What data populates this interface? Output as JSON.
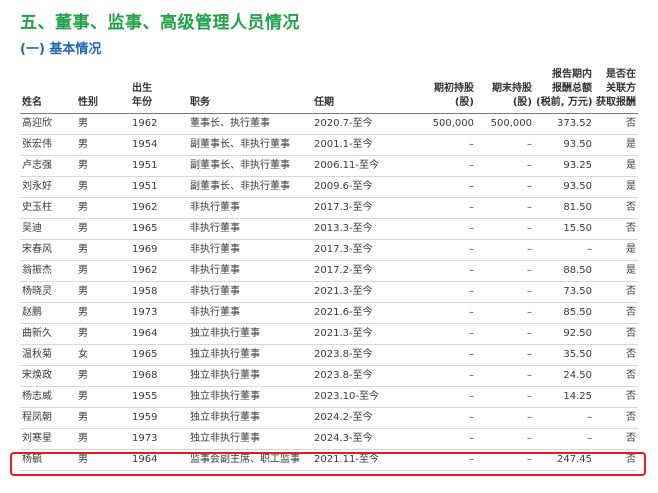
{
  "section_title": "五、董事、监事、高级管理人员情况",
  "subsection_title": "(一) 基本情况",
  "headers": {
    "name": "姓名",
    "gender": "性别",
    "birth_line1": "出生",
    "birth_line2": "年份",
    "position": "职务",
    "term": "任期",
    "start_shares_line1": "期初持股",
    "start_shares_line2": "(股)",
    "end_shares_line1": "期末持股",
    "end_shares_line2": "(股)",
    "pay_line1": "报告期内",
    "pay_line2": "报酬总额",
    "pay_line3": "(税前, 万元)",
    "related_line1": "是否在",
    "related_line2": "关联方",
    "related_line3": "获取报酬"
  },
  "rows": [
    {
      "name": "高迎欣",
      "gender": "男",
      "birth": "1962",
      "position": "董事长、执行董事",
      "term": "2020.7-至今",
      "start_shares": "500,000",
      "end_shares": "500,000",
      "pay": "373.52",
      "related": "否"
    },
    {
      "name": "张宏伟",
      "gender": "男",
      "birth": "1954",
      "position": "副董事长、非执行董事",
      "term": "2001.1-至今",
      "start_shares": "–",
      "end_shares": "–",
      "pay": "93.50",
      "related": "是"
    },
    {
      "name": "卢志强",
      "gender": "男",
      "birth": "1951",
      "position": "副董事长、非执行董事",
      "term": "2006.11-至今",
      "start_shares": "–",
      "end_shares": "–",
      "pay": "93.25",
      "related": "是"
    },
    {
      "name": "刘永好",
      "gender": "男",
      "birth": "1951",
      "position": "副董事长、非执行董事",
      "term": "2009.6-至今",
      "start_shares": "–",
      "end_shares": "–",
      "pay": "93.50",
      "related": "是"
    },
    {
      "name": "史玉柱",
      "gender": "男",
      "birth": "1962",
      "position": "非执行董事",
      "term": "2017.3-至今",
      "start_shares": "–",
      "end_shares": "–",
      "pay": "81.50",
      "related": "否"
    },
    {
      "name": "吴迪",
      "gender": "男",
      "birth": "1965",
      "position": "非执行董事",
      "term": "2013.3-至今",
      "start_shares": "–",
      "end_shares": "–",
      "pay": "15.50",
      "related": "否"
    },
    {
      "name": "宋春风",
      "gender": "男",
      "birth": "1969",
      "position": "非执行董事",
      "term": "2017.3-至今",
      "start_shares": "–",
      "end_shares": "–",
      "pay": "–",
      "related": "是"
    },
    {
      "name": "翁振杰",
      "gender": "男",
      "birth": "1962",
      "position": "非执行董事",
      "term": "2017.2-至今",
      "start_shares": "–",
      "end_shares": "–",
      "pay": "88.50",
      "related": "是"
    },
    {
      "name": "杨晓灵",
      "gender": "男",
      "birth": "1958",
      "position": "非执行董事",
      "term": "2021.3-至今",
      "start_shares": "–",
      "end_shares": "–",
      "pay": "73.50",
      "related": "否"
    },
    {
      "name": "赵鹏",
      "gender": "男",
      "birth": "1973",
      "position": "非执行董事",
      "term": "2021.6-至今",
      "start_shares": "–",
      "end_shares": "–",
      "pay": "85.50",
      "related": "否"
    },
    {
      "name": "曲新久",
      "gender": "男",
      "birth": "1964",
      "position": "独立非执行董事",
      "term": "2021.3-至今",
      "start_shares": "–",
      "end_shares": "–",
      "pay": "92.50",
      "related": "否"
    },
    {
      "name": "温秋菊",
      "gender": "女",
      "birth": "1965",
      "position": "独立非执行董事",
      "term": "2023.8-至今",
      "start_shares": "–",
      "end_shares": "–",
      "pay": "35.50",
      "related": "否"
    },
    {
      "name": "宋焕政",
      "gender": "男",
      "birth": "1968",
      "position": "独立非执行董事",
      "term": "2023.8-至今",
      "start_shares": "–",
      "end_shares": "–",
      "pay": "24.50",
      "related": "否"
    },
    {
      "name": "杨志威",
      "gender": "男",
      "birth": "1955",
      "position": "独立非执行董事",
      "term": "2023.10-至今",
      "start_shares": "–",
      "end_shares": "–",
      "pay": "14.25",
      "related": "否"
    },
    {
      "name": "程凤朝",
      "gender": "男",
      "birth": "1959",
      "position": "独立非执行董事",
      "term": "2024.2-至今",
      "start_shares": "–",
      "end_shares": "–",
      "pay": "–",
      "related": "否"
    },
    {
      "name": "刘寒星",
      "gender": "男",
      "birth": "1973",
      "position": "独立非执行董事",
      "term": "2024.3-至今",
      "start_shares": "–",
      "end_shares": "–",
      "pay": "–",
      "related": "否"
    },
    {
      "name": "杨毓",
      "gender": "男",
      "birth": "1964",
      "position": "监事会副主席、职工监事",
      "term": "2021.11-至今",
      "start_shares": "–",
      "end_shares": "–",
      "pay": "247.45",
      "related": "否"
    }
  ],
  "highlight_color": "#e01e1e",
  "title_color": "#22a04a",
  "subtitle_color": "#1f66b0"
}
